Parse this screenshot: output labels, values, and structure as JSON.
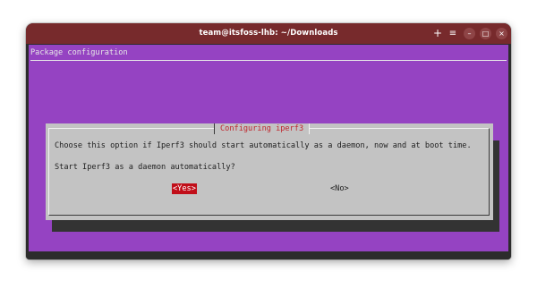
{
  "window": {
    "title": "team@itsfoss-lhb: ~/Downloads",
    "titlebar_color": "#772a2c",
    "icons": {
      "new_tab": "+",
      "menu": "≡",
      "minimize": "–",
      "maximize": "□",
      "close": "×"
    }
  },
  "terminal": {
    "background_color": "#9543c2",
    "header_text": "Package configuration"
  },
  "dialog": {
    "title": "Configuring iperf3",
    "message_line1": "Choose this option if Iperf3 should start automatically as a daemon, now and at boot time.",
    "message_line2": "Start Iperf3 as a daemon automatically?",
    "yes_label": "<Yes>",
    "no_label": "<No>",
    "selected_button": "yes",
    "background_color": "#c3c3c3",
    "accent_color": "#c10e19"
  }
}
